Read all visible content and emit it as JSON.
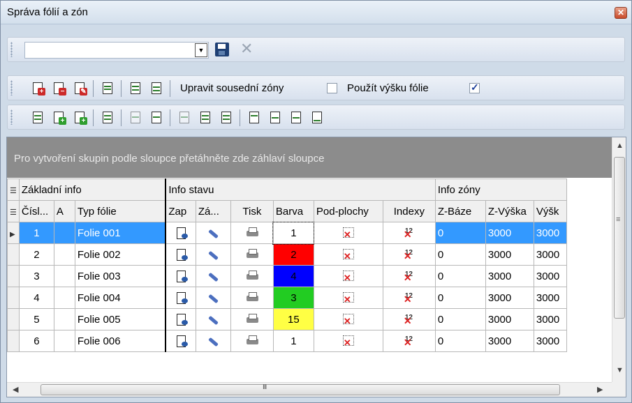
{
  "window": {
    "title": "Správa fólií a zón",
    "close_icon": "close-icon"
  },
  "toolbar1": {
    "combo_value": "",
    "save_icon": "floppy-save-icon",
    "delete_icon": "x-delete-icon"
  },
  "toolbar2": {
    "icons": [
      "layer-add-icon",
      "layer-remove-icon",
      "layer-edit-icon",
      "layer-save-icon",
      "layer-copy-icon",
      "layer-paste-icon"
    ],
    "upravit_label": "Upravit sousední zóny",
    "upravit_checked": false,
    "pouzit_label": "Použít výšku fólie",
    "pouzit_checked": true
  },
  "toolbar3": {
    "icons": [
      "zone-new-icon",
      "zone-add-icon",
      "zone-add-green-icon",
      "zone-list-icon",
      "zone-delete-icon",
      "zone-edit-icon",
      "zone-disabled-icon",
      "zone-stack-icon",
      "zone-stack-green-icon",
      "zone-move-up-icon",
      "zone-move-icon",
      "zone-move-alt-icon",
      "zone-move-down-icon"
    ]
  },
  "grid": {
    "group_hint": "Pro vytvoření skupin podle sloupce přetáhněte zde záhlaví sloupce",
    "groups": {
      "basic": "Základní info",
      "state": "Info stavu",
      "zone": "Info zóny"
    },
    "headers": {
      "num": "Čísl...",
      "a": "A",
      "type": "Typ fólie",
      "zap": "Zap",
      "za": "Zá...",
      "tisk": "Tisk",
      "barva": "Barva",
      "pod": "Pod-plochy",
      "idx": "Indexy",
      "zbaze": "Z-Báze",
      "zvyska": "Z-Výška",
      "vysk": "Výšk"
    },
    "rows": [
      {
        "num": "1",
        "type": "Folie 001",
        "barva": "1",
        "color": "#ffffff",
        "zbaze": "0",
        "zvyska": "3000",
        "vysk": "3000",
        "selected": true
      },
      {
        "num": "2",
        "type": "Folie 002",
        "barva": "2",
        "color": "#ff0000",
        "zbaze": "0",
        "zvyska": "3000",
        "vysk": "3000"
      },
      {
        "num": "3",
        "type": "Folie 003",
        "barva": "4",
        "color": "#0000ff",
        "zbaze": "0",
        "zvyska": "3000",
        "vysk": "3000"
      },
      {
        "num": "4",
        "type": "Folie 004",
        "barva": "3",
        "color": "#22cc22",
        "zbaze": "0",
        "zvyska": "3000",
        "vysk": "3000"
      },
      {
        "num": "5",
        "type": "Folie 005",
        "barva": "15",
        "color": "#ffff44",
        "zbaze": "0",
        "zvyska": "3000",
        "vysk": "3000"
      },
      {
        "num": "6",
        "type": "Folie 006",
        "barva": "1",
        "color": "#ffffff",
        "zbaze": "0",
        "zvyska": "3000",
        "vysk": "3000"
      }
    ]
  },
  "scroll": {
    "hscroll_grip": "III"
  }
}
